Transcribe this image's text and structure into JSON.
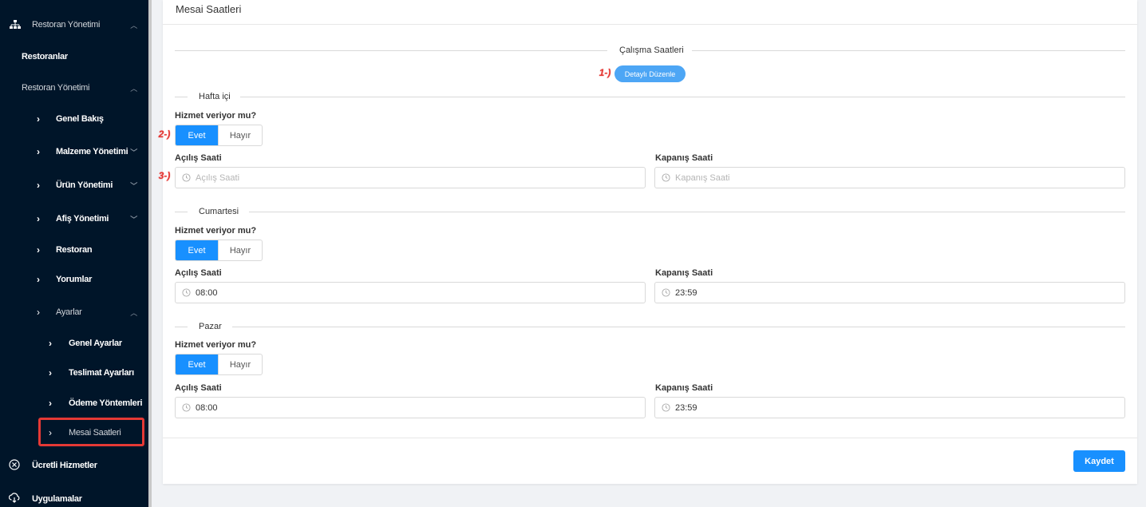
{
  "sidebar": {
    "section1": "Restoran Yönetimi",
    "restoranlar": "Restoranlar",
    "section2": "Restoran Yönetimi",
    "genel_bakis": "Genel Bakış",
    "malzeme": "Malzeme Yönetimi",
    "urun": "Ürün Yönetimi",
    "afis": "Afiş Yönetimi",
    "restoran": "Restoran",
    "yorumlar": "Yorumlar",
    "ayarlar": "Ayarlar",
    "genel_ayarlar": "Genel Ayarlar",
    "teslimat": "Teslimat Ayarları",
    "odeme": "Ödeme Yöntemleri",
    "mesai": "Mesai Saatleri",
    "ucretli": "Ücretli Hizmetler",
    "uygulamalar": "Uygulamalar"
  },
  "page": {
    "title": "Mesai Saatleri",
    "section_title": "Çalışma Saatleri",
    "detail_button": "Detaylı Düzenle",
    "save_button": "Kaydet"
  },
  "annotations": [
    "1-)",
    "2-)",
    "3-)"
  ],
  "days": [
    {
      "name": "Hafta içi",
      "service_label": "Hizmet veriyor mu?",
      "yes": "Evet",
      "no": "Hayır",
      "open_label": "Açılış Saati",
      "close_label": "Kapanış Saati",
      "open_value": "",
      "close_value": "",
      "open_placeholder": "Açılış Saati",
      "close_placeholder": "Kapanış Saati"
    },
    {
      "name": "Cumartesi",
      "service_label": "Hizmet veriyor mu?",
      "yes": "Evet",
      "no": "Hayır",
      "open_label": "Açılış Saati",
      "close_label": "Kapanış Saati",
      "open_value": "08:00",
      "close_value": "23:59"
    },
    {
      "name": "Pazar",
      "service_label": "Hizmet veriyor mu?",
      "yes": "Evet",
      "no": "Hayır",
      "open_label": "Açılış Saati",
      "close_label": "Kapanış Saati",
      "open_value": "08:00",
      "close_value": "23:59"
    }
  ],
  "colors": {
    "sidebar_bg": "#001529",
    "primary": "#1890ff",
    "annotation": "#e53935"
  }
}
